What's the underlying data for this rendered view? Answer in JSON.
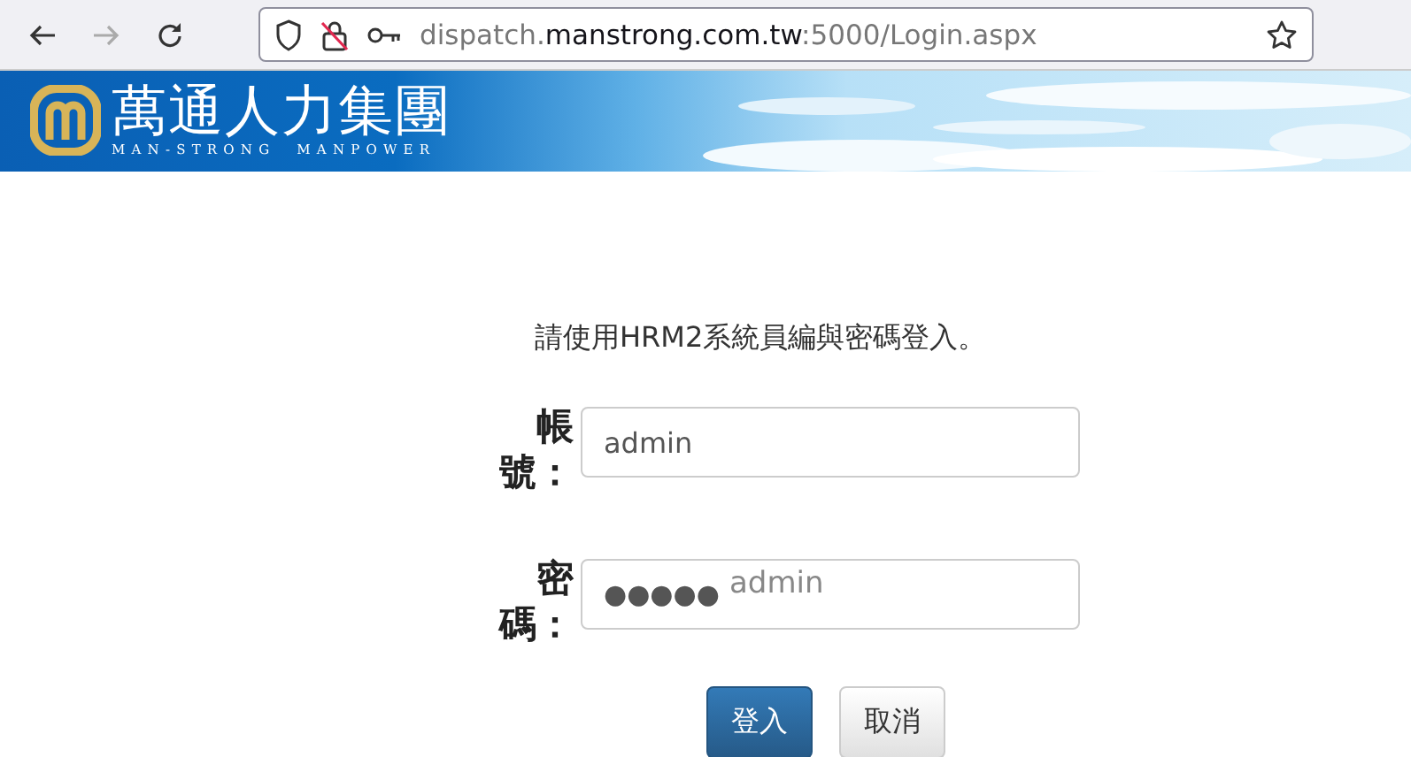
{
  "browser": {
    "url": {
      "prefix": "dispatch.",
      "domain": "manstrong.com.tw",
      "suffix": ":5000/Login.aspx"
    },
    "forward_disabled": true
  },
  "banner": {
    "logo_text": "萬通人力集團",
    "logo_subtitle": "MAN-STRONG  MANPOWER"
  },
  "login": {
    "instruction": "請使用HRM2系統員編與密碼登入。",
    "fields": [
      {
        "kind": "text",
        "label": "帳號：",
        "value": "admin"
      },
      {
        "kind": "password",
        "label": "密碼：",
        "value": "●●●●●",
        "hint": "admin"
      }
    ],
    "buttons": [
      {
        "label": "登入",
        "primary": true
      },
      {
        "label": "取消",
        "primary": false
      }
    ]
  }
}
